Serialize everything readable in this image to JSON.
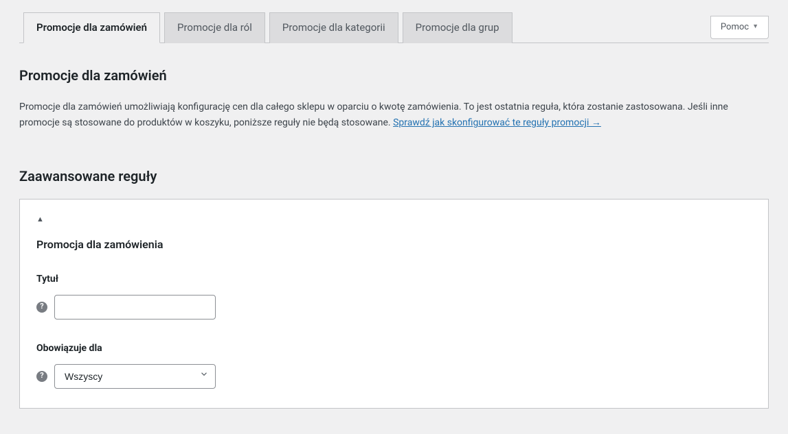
{
  "help": {
    "label": "Pomoc"
  },
  "tabs": [
    {
      "label": "Promocje dla zamówień",
      "active": true
    },
    {
      "label": "Promocje dla ról",
      "active": false
    },
    {
      "label": "Promocje dla kategorii",
      "active": false
    },
    {
      "label": "Promocje dla grup",
      "active": false
    }
  ],
  "page_title": "Promocje dla zamówień",
  "description_text": "Promocje dla zamówień umożliwiają konfigurację cen dla całego sklepu w oparciu o kwotę zamówienia. To jest ostatnia reguła, która zostanie zastosowana. Jeśli inne promocje są stosowane do produktów w koszyku, poniższe reguły nie będą stosowane. ",
  "description_link": "Sprawdź jak skonfigurować te reguły promocji →",
  "advanced_rules_title": "Zaawansowane reguły",
  "rule": {
    "title": "Promocja dla zamówienia",
    "fields": {
      "title": {
        "label": "Tytuł",
        "value": ""
      },
      "applies_to": {
        "label": "Obowiązuje dla",
        "value": "Wszyscy"
      }
    }
  }
}
